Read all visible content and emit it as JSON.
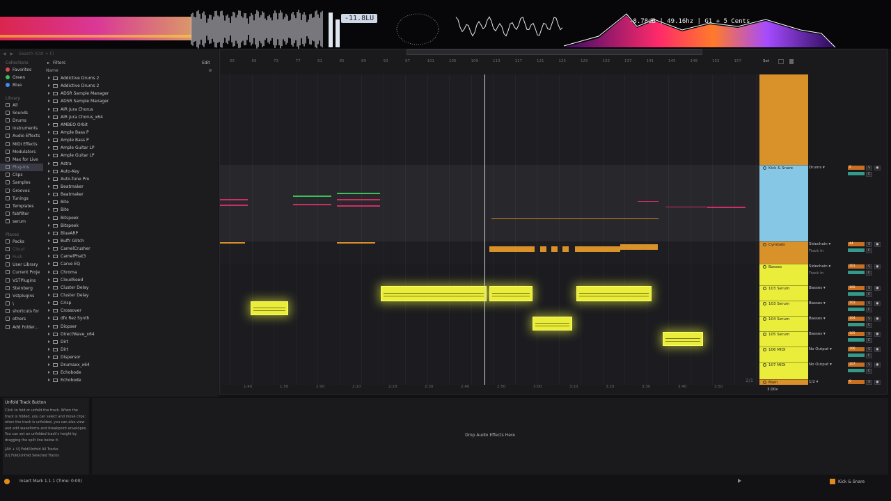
{
  "visualizer": {
    "lufs": "-11.8LU",
    "pitch": "-8.78dB | 49.16hz | G1 + 5 Cents"
  },
  "browser": {
    "search_placeholder": "Search (Ctrl + F)",
    "filters_label": "Filters",
    "edit_label": "Edit",
    "name_header": "Name",
    "collections_head": "Collections",
    "collections": [
      {
        "label": "Favorites",
        "color": "#d94b4b"
      },
      {
        "label": "Green",
        "color": "#3ec15a"
      },
      {
        "label": "Blue",
        "color": "#3d8ef0"
      }
    ],
    "library_head": "Library",
    "library": [
      "All",
      "Sounds",
      "Drums",
      "Instruments",
      "Audio Effects",
      "MIDI Effects",
      "Modulators",
      "Max for Live",
      "Plug-ins",
      "Clips",
      "Samples",
      "Grooves",
      "Tunings",
      "Templates",
      "fabfilter",
      "serum"
    ],
    "library_selected": "Plug-ins",
    "places_head": "Places",
    "places": [
      "Packs",
      "Cloud",
      "Push",
      "User Library",
      "Current Proje",
      "VSTPlugins",
      "Steinberg",
      "Vstplugins",
      "\\",
      "shortcuts for",
      "others",
      "Add Folder..."
    ],
    "plugins": [
      "Addictive Drums 2",
      "Addictive Drums 2",
      "ADSR Sample Manager",
      "ADSR Sample Manager",
      "AIR Jura Chorus",
      "AIR Jura Chorus_x64",
      "AMBEO Orbit",
      "Ample Bass P",
      "Ample Bass P",
      "Ample Guitar LP",
      "Ample Guitar LP",
      "Astra",
      "Auto-Key",
      "Auto-Tune Pro",
      "Beatmaker",
      "Beatmaker",
      "Bite",
      "Bite",
      "Bitspeek",
      "Bitspeek",
      "BlueARP",
      "Buffr Glitch",
      "CamelCrusher",
      "CamelPhat3",
      "Carve EQ",
      "Chroma",
      "CloudSeed",
      "Cluster Delay",
      "Cluster Delay",
      "Crisp",
      "Crossover",
      "dfx Rez Synth",
      "Diopser",
      "DirectWave_x64",
      "Dirt",
      "Dirt",
      "Dispersor",
      "Drumaxx_x64",
      "Echobode",
      "Echobode"
    ]
  },
  "arrangement": {
    "set_label": "Set",
    "bar_ruler": [
      "65",
      "69",
      "73",
      "77",
      "81",
      "85",
      "89",
      "93",
      "97",
      "101",
      "105",
      "109",
      "113",
      "117",
      "121",
      "125",
      "129",
      "133",
      "137",
      "141",
      "145",
      "149",
      "153",
      "157"
    ],
    "time_ruler": [
      "1:40",
      "1:50",
      "2:00",
      "2:10",
      "2:20",
      "2:30",
      "2:40",
      "2:50",
      "3:00",
      "3:10",
      "3:20",
      "3:30",
      "3:40",
      "3:50"
    ],
    "zoom_fraction": "2/1",
    "tempo_text": "3.00x",
    "tracks": [
      {
        "name": "Kick & Snare",
        "route": "Drums",
        "route2": "",
        "vol": "2",
        "color": "#86c7e6"
      },
      {
        "name": "Cymbals",
        "route": "Sidechain",
        "route2": "Track In",
        "vol": "44",
        "color": "#d9912a"
      },
      {
        "name": "Basses",
        "route": "Sidechain",
        "route2": "Track In",
        "vol": "101",
        "color": "#eaee3a"
      },
      {
        "name": "103 Serum",
        "route": "Basses",
        "route2": "",
        "vol": "102",
        "color": "#eaee3a"
      },
      {
        "name": "103 Serum",
        "route": "Basses",
        "route2": "",
        "vol": "103",
        "color": "#eaee3a"
      },
      {
        "name": "104 Serum",
        "route": "Basses",
        "route2": "",
        "vol": "104",
        "color": "#eaee3a"
      },
      {
        "name": "105 Serum",
        "route": "Basses",
        "route2": "",
        "vol": "105",
        "color": "#eaee3a"
      },
      {
        "name": "106 MIDI",
        "route": "No Output",
        "route2": "",
        "vol": "106",
        "color": "#eaee3a"
      },
      {
        "name": "107 MIDI",
        "route": "No Output",
        "route2": "",
        "vol": "107",
        "color": "#eaee3a"
      },
      {
        "name": "Main",
        "route": "1/2",
        "route2": "",
        "vol": "0",
        "color": "#d9912a"
      }
    ]
  },
  "info": {
    "title": "Unfold Track Button",
    "body": "Click to fold or unfold the track. When the track is folded, you can select and move clips; when the track is unfolded, you can also view and edit waveforms and breakpoint envelopes. You can set an unfolded track's height by dragging the split line below it.",
    "shortcut1": "[Alt + U] Fold/Unfold All Tracks",
    "shortcut2": "[U] Fold/Unfold Selected Tracks"
  },
  "detail": {
    "drop_text": "Drop Audio Effects Here"
  },
  "status": {
    "message": "Insert Mark 1.1.1 (Time: 0:00)",
    "track": "Kick & Snare"
  },
  "colors": {
    "accent_yellow": "#eaee3a",
    "orange": "#d9912a",
    "blue_track": "#86c7e6"
  }
}
